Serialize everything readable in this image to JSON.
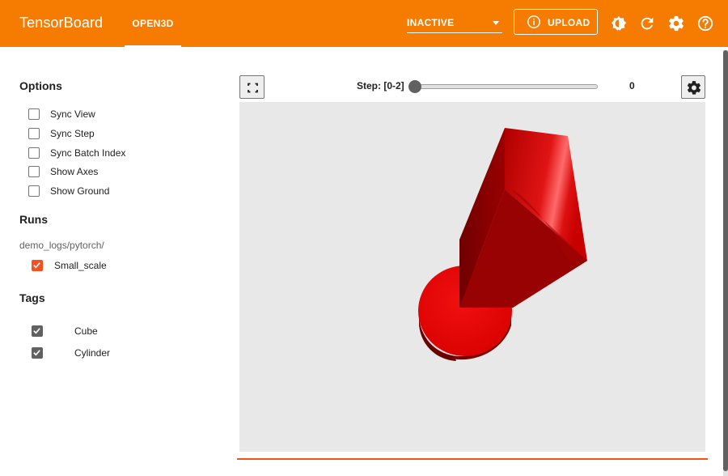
{
  "header": {
    "brand": "TensorBoard",
    "active_plugin": "OPEN3D",
    "run_status": "INACTIVE",
    "upload_label": "UPLOAD",
    "icons": [
      "dark-mode-icon",
      "refresh-icon",
      "settings-icon",
      "help-icon"
    ],
    "background_color": "#f57c00"
  },
  "sidebar": {
    "options_title": "Options",
    "options": [
      {
        "label": "Sync View",
        "checked": false
      },
      {
        "label": "Sync Step",
        "checked": false
      },
      {
        "label": "Sync Batch Index",
        "checked": false
      },
      {
        "label": "Show Axes",
        "checked": false
      },
      {
        "label": "Show Ground",
        "checked": false
      }
    ],
    "runs_title": "Runs",
    "run_path": "demo_logs/pytorch/",
    "runs": [
      {
        "label": "Small_scale",
        "checked": true,
        "color": "#f4511e"
      }
    ],
    "tags_title": "Tags",
    "tags": [
      {
        "label": "Cube",
        "checked": true
      },
      {
        "label": "Cylinder",
        "checked": true
      }
    ]
  },
  "viewer": {
    "step_label": "Step: [0-2]",
    "step_min": 0,
    "step_max": 2,
    "step_value": "0",
    "canvas_background": "#e8e8e8",
    "object_color": "#cc0000",
    "progress_color": "#f4511e"
  }
}
